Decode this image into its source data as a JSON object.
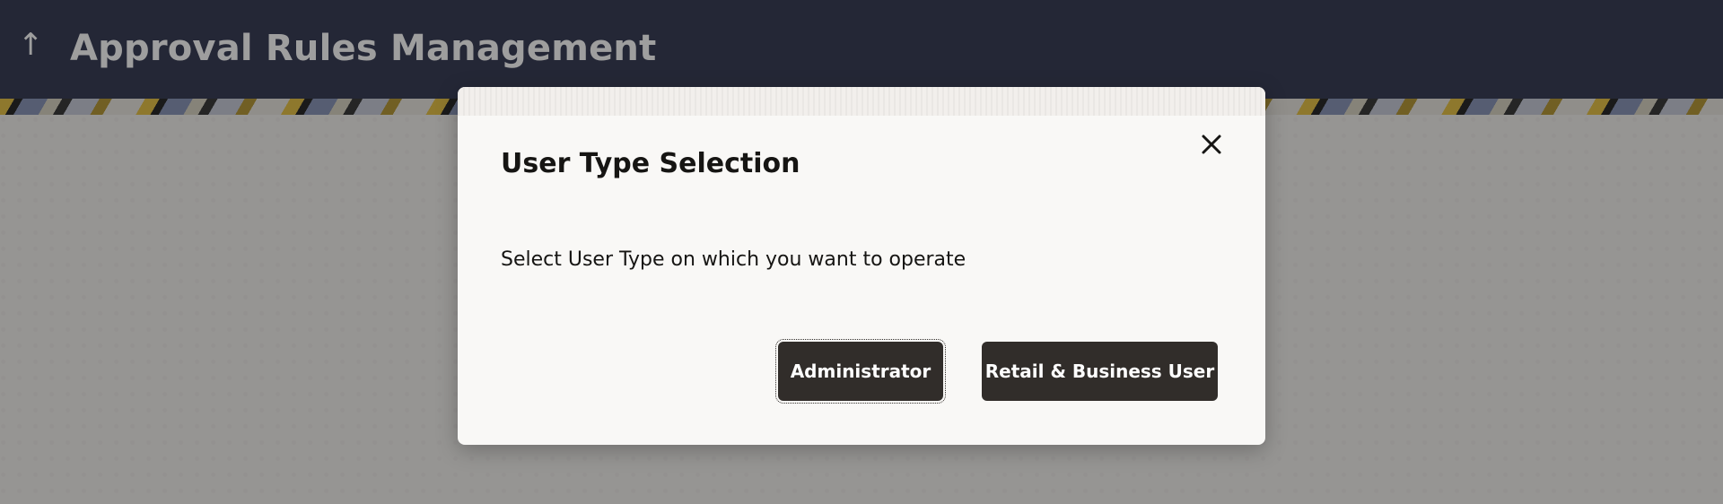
{
  "header": {
    "title": "Approval Rules Management",
    "back_icon": "↑"
  },
  "modal": {
    "title": "User Type Selection",
    "message": "Select User Type on which you want to operate",
    "close_icon": "close-icon",
    "buttons": {
      "administrator": "Administrator",
      "retail_business": "Retail & Business User"
    }
  },
  "colors": {
    "header_bg": "#3a3f58",
    "button_bg": "#312d2a",
    "modal_bg": "#f9f8f6"
  }
}
